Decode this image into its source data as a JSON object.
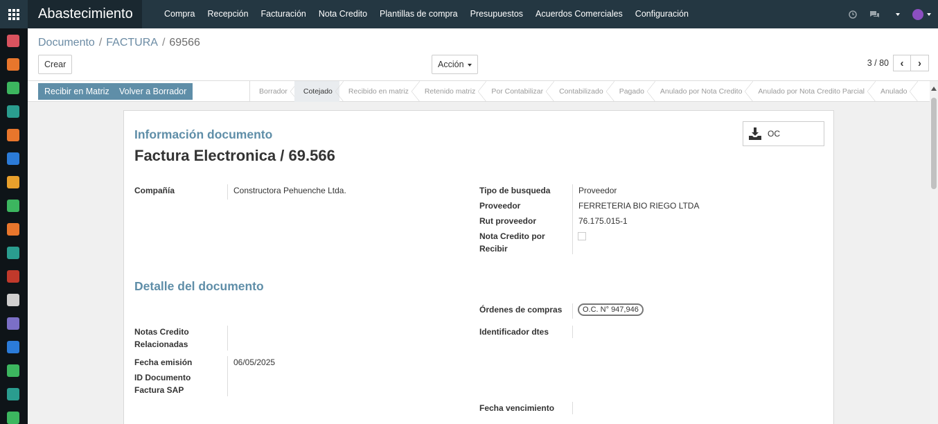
{
  "app": {
    "title": "Abastecimiento"
  },
  "menu": [
    "Compra",
    "Recepción",
    "Facturación",
    "Nota Credito",
    "Plantillas de compra",
    "Presupuestos",
    "Acuerdos Comerciales",
    "Configuración"
  ],
  "breadcrumb": {
    "parent": "Documento",
    "mid": "FACTURA",
    "current": "69566"
  },
  "toolbar": {
    "create_label": "Crear",
    "action_label": "Acción"
  },
  "pager": {
    "value": "3 / 80"
  },
  "header_buttons": {
    "receive": "Recibir en Matriz",
    "back_draft": "Volver a Borrador"
  },
  "stages": [
    {
      "label": "Borrador",
      "active": false
    },
    {
      "label": "Cotejado",
      "active": true
    },
    {
      "label": "Recibido en matriz",
      "active": false
    },
    {
      "label": "Retenido matriz",
      "active": false
    },
    {
      "label": "Por Contabilizar",
      "active": false
    },
    {
      "label": "Contabilizado",
      "active": false
    },
    {
      "label": "Pagado",
      "active": false
    },
    {
      "label": "Anulado por Nota Credito",
      "active": false
    },
    {
      "label": "Anulado por Nota Credito Parcial",
      "active": false
    },
    {
      "label": "Anulado",
      "active": false
    }
  ],
  "form": {
    "oc_button": "OC",
    "section_info": "Información documento",
    "title": "Factura Electronica / 69.566",
    "company_label": "Compañía",
    "company_value": "Constructora Pehuenche Ltda.",
    "search_type_label": "Tipo de busqueda",
    "search_type_value": "Proveedor",
    "supplier_label": "Proveedor",
    "supplier_value": "FERRETERIA BIO RIEGO LTDA",
    "rut_label": "Rut proveedor",
    "rut_value": "76.175.015-1",
    "nc_receive_label": "Nota Credito por Recibir",
    "section_detail": "Detalle del documento",
    "orders_label": "Órdenes de compras",
    "orders_tag": "O.C. N° 947,946",
    "nc_related_label": "Notas Credito Relacionadas",
    "dte_label": "Identificador dtes",
    "emission_label": "Fecha emisión",
    "emission_value": "06/05/2025",
    "sap_id_label": "ID Documento Factura SAP",
    "due_label": "Fecha vencimiento"
  },
  "colors": {
    "navbar": "#243742",
    "accent": "#5f8ea8"
  },
  "left_apps": [
    {
      "icon": "chat-app-icon",
      "color": "#d9535f"
    },
    {
      "icon": "handshake-app-icon",
      "color": "#e8762c"
    },
    {
      "icon": "sms-app-icon",
      "color": "#3cb65f"
    },
    {
      "icon": "contacts-app-icon",
      "color": "#2a9d8f"
    },
    {
      "icon": "globe-app-icon",
      "color": "#e8762c"
    },
    {
      "icon": "home-app-icon",
      "color": "#2b7bd8"
    },
    {
      "icon": "documents-app-icon",
      "color": "#e8a02c"
    },
    {
      "icon": "tools-app-icon",
      "color": "#3cb65f"
    },
    {
      "icon": "invoice-app-icon",
      "color": "#e8762c"
    },
    {
      "icon": "notes-app-icon",
      "color": "#2a9d8f"
    },
    {
      "icon": "cart-app-icon",
      "color": "#c0392b"
    },
    {
      "icon": "hammer-app-icon",
      "color": "#cfcfcf"
    },
    {
      "icon": "deal-app-icon",
      "color": "#7b6fc6"
    },
    {
      "icon": "wrench-app-icon",
      "color": "#2b7bd8"
    },
    {
      "icon": "clipboard-app-icon",
      "color": "#3cb65f"
    },
    {
      "icon": "table-app-icon",
      "color": "#2a9d8f"
    },
    {
      "icon": "clock-app-icon",
      "color": "#3cb65f"
    }
  ]
}
